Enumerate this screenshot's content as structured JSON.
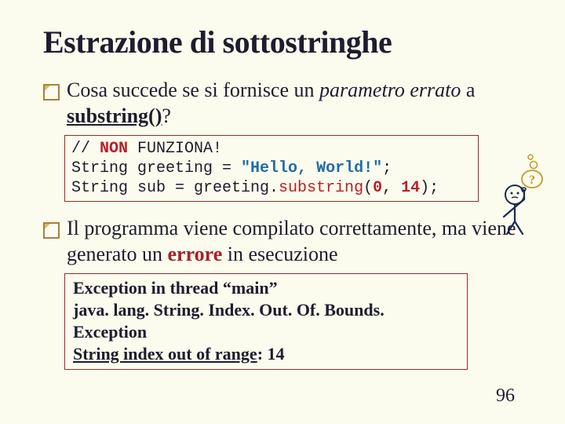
{
  "title": "Estrazione di sottostringhe",
  "bullet1": {
    "pre": "Cosa succede se si fornisce un ",
    "param": "parametro errato",
    "mid": " a ",
    "fn": "substring()",
    "post": "?"
  },
  "code": {
    "l1_a": "// ",
    "l1_b": "NON",
    "l1_c": " FUNZIONA!",
    "l2_a": "String greeting = ",
    "l2_b": "\"Hello, World!\"",
    "l2_c": ";",
    "l3_a": "String sub = greeting.",
    "l3_b": "substring",
    "l3_c": "(",
    "l3_d": "0",
    "l3_e": ", ",
    "l3_f": "14",
    "l3_g": ");"
  },
  "bullet2": {
    "pre": "Il programma viene compilato correttamente, ma viene generato un ",
    "err": "errore",
    "post": " in esecuzione"
  },
  "exception": {
    "l1": "Exception in thread “main”",
    "l2": "java. lang. String. Index. Out. Of. Bounds. Exception",
    "l3a": "String index out of range",
    "l3b": ": 14"
  },
  "page": "96"
}
